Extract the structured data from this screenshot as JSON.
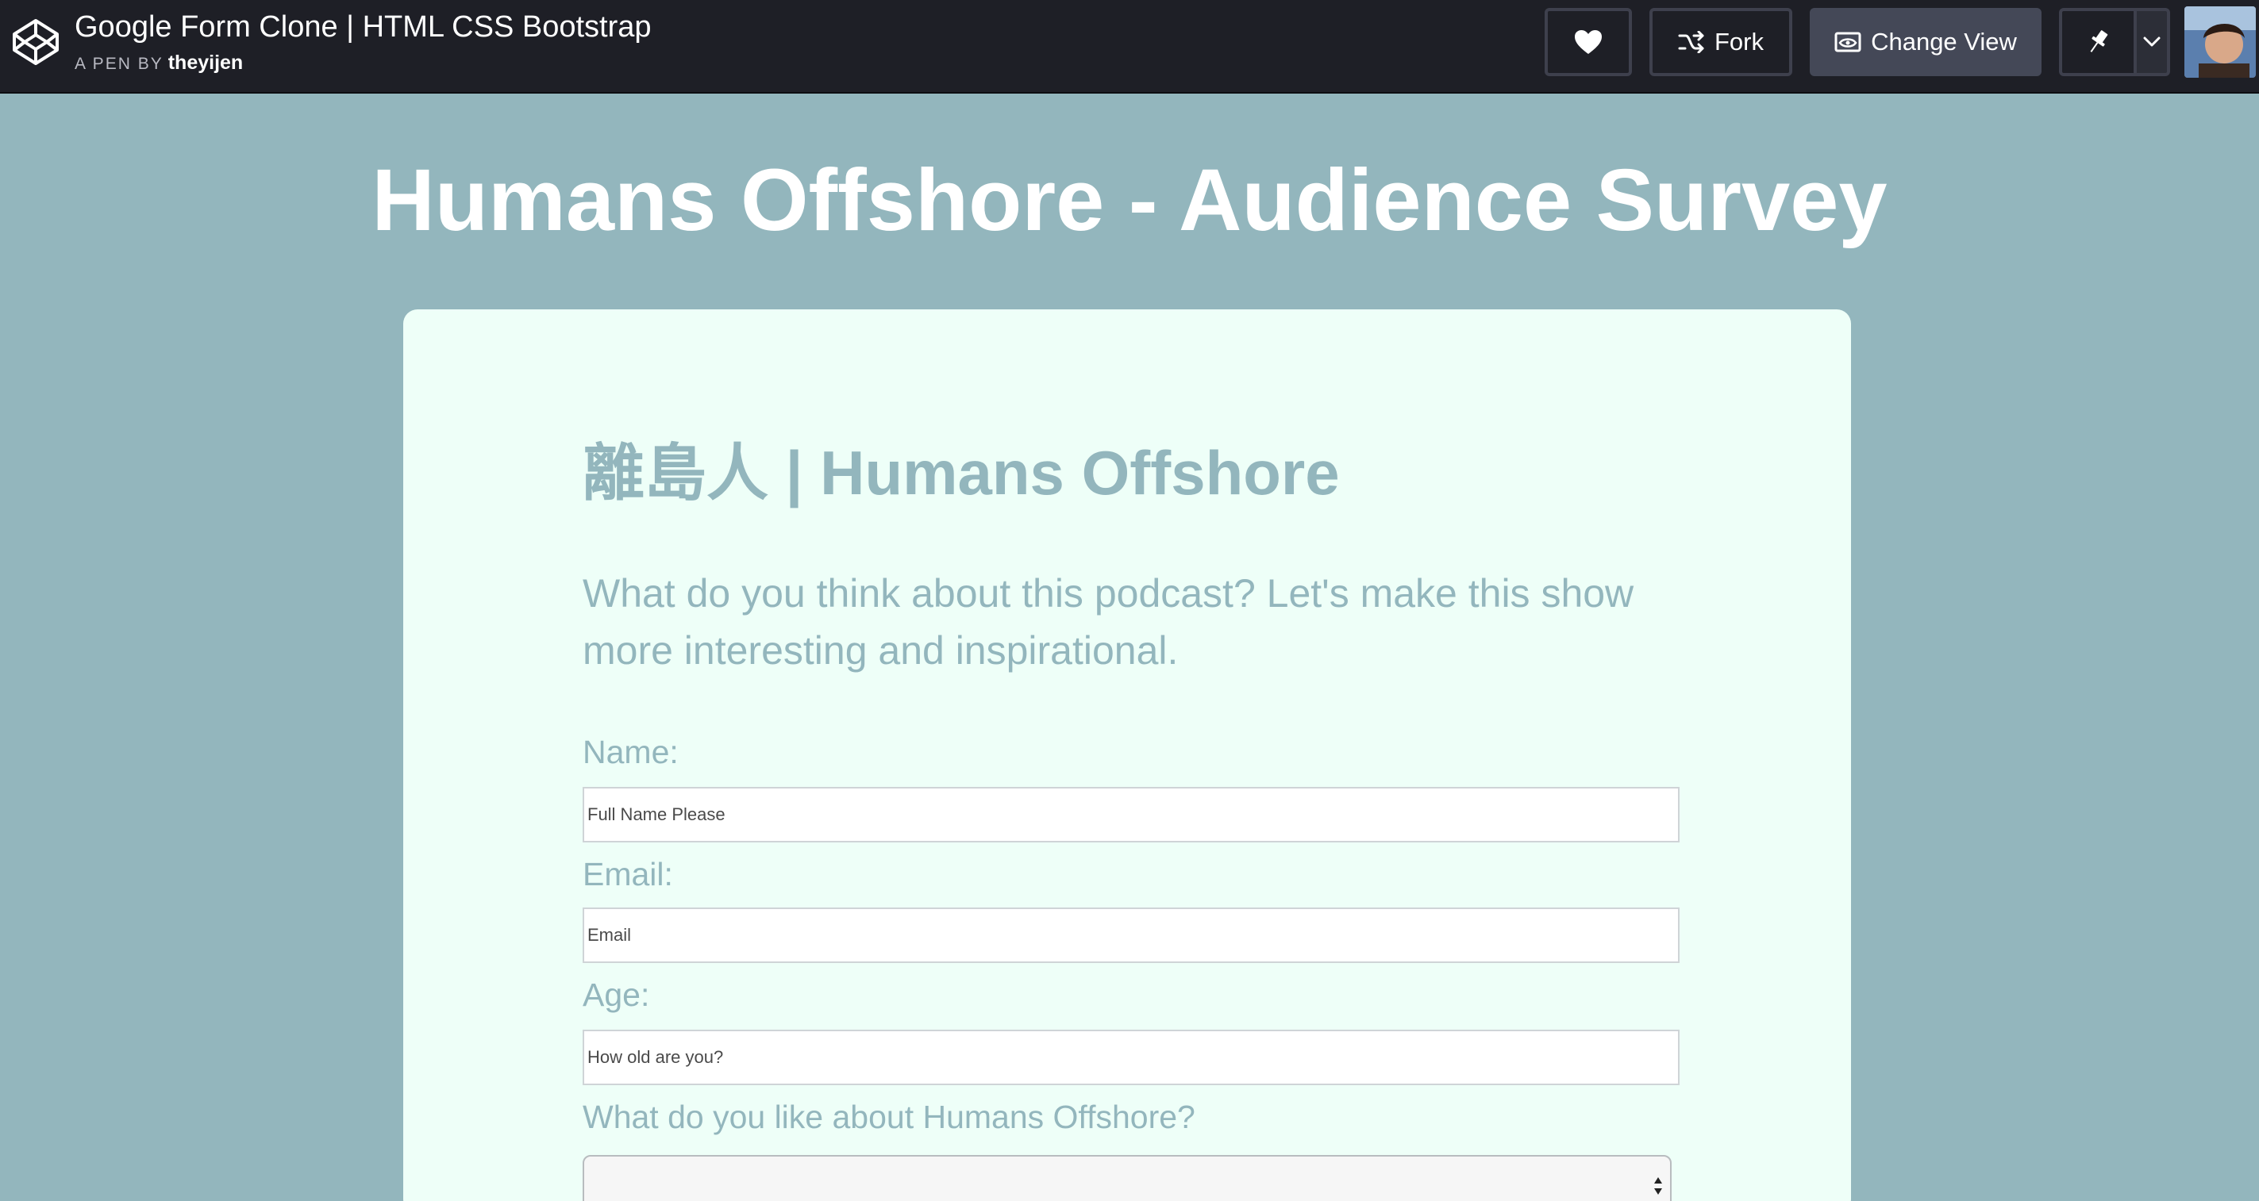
{
  "topbar": {
    "pen_title": "Google Form Clone | HTML CSS Bootstrap",
    "pen_by_label": "A PEN BY",
    "author": "theyijen",
    "buttons": {
      "heart": "heart-icon",
      "fork_label": "Fork",
      "change_view_label": "Change View",
      "pin": "pin-icon",
      "dropdown": "chevron-down-icon"
    }
  },
  "page": {
    "title": "Humans Offshore - Audience Survey"
  },
  "form": {
    "heading": "離島人 | Humans Offshore",
    "description": "What do you think about this podcast? Let's make this show more interesting and inspirational.",
    "fields": {
      "name": {
        "label": "Name:",
        "placeholder": "Full Name Please"
      },
      "email": {
        "label": "Email:",
        "placeholder": "Email"
      },
      "age": {
        "label": "Age:",
        "placeholder": "How old are you?"
      }
    },
    "like_question": {
      "label": "What do you like about Humans Offshore?",
      "selected": ""
    }
  },
  "colors": {
    "background": "#93b6bd",
    "topbar": "#1e1f26",
    "card": "#eefff8",
    "accent_text": "#93b6bd"
  }
}
